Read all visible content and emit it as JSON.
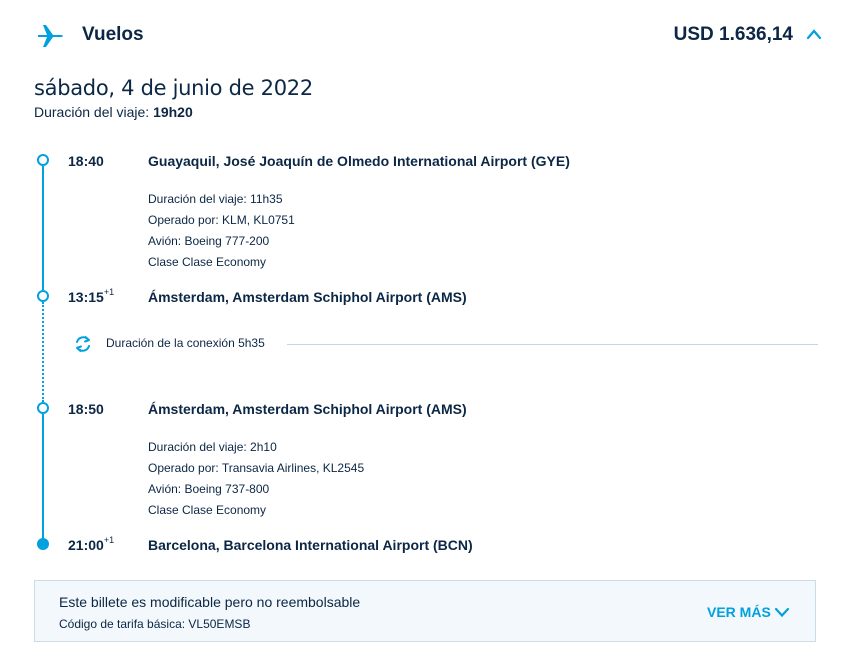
{
  "header": {
    "title": "Vuelos",
    "price": "USD 1.636,14",
    "accent_color": "#00a1de"
  },
  "trip": {
    "date": "sábado, 4 de junio de 2022",
    "duration_label": "Duración del viaje:",
    "duration_value": "19h20"
  },
  "segments": [
    {
      "dep_time": "18:40",
      "dep_airport": "Guayaquil, José Joaquín de Olmedo International Airport (GYE)",
      "duration": "Duración del viaje: 11h35",
      "operated": "Operado por: KLM, KL0751",
      "aircraft": "Avión: Boeing 777-200",
      "cabin": "Clase Clase Economy",
      "arr_time": "13:15",
      "arr_offset": "+1",
      "arr_airport": "Ámsterdam, Amsterdam Schiphol Airport (AMS)"
    },
    {
      "dep_time": "18:50",
      "dep_airport": "Ámsterdam, Amsterdam Schiphol Airport (AMS)",
      "duration": "Duración del viaje: 2h10",
      "operated": "Operado por: Transavia Airlines, KL2545",
      "aircraft": "Avión: Boeing 737-800",
      "cabin": "Clase Clase Economy",
      "arr_time": "21:00",
      "arr_offset": "+1",
      "arr_airport": "Barcelona, Barcelona International Airport (BCN)"
    }
  ],
  "connection": {
    "label": "Duración de la conexión 5h35",
    "icon": "refresh-icon"
  },
  "fare": {
    "title": "Este billete es modificable pero no reembolsable",
    "code": "Código de tarifa básica: VL50EMSB",
    "more_label": "VER MÁS"
  }
}
